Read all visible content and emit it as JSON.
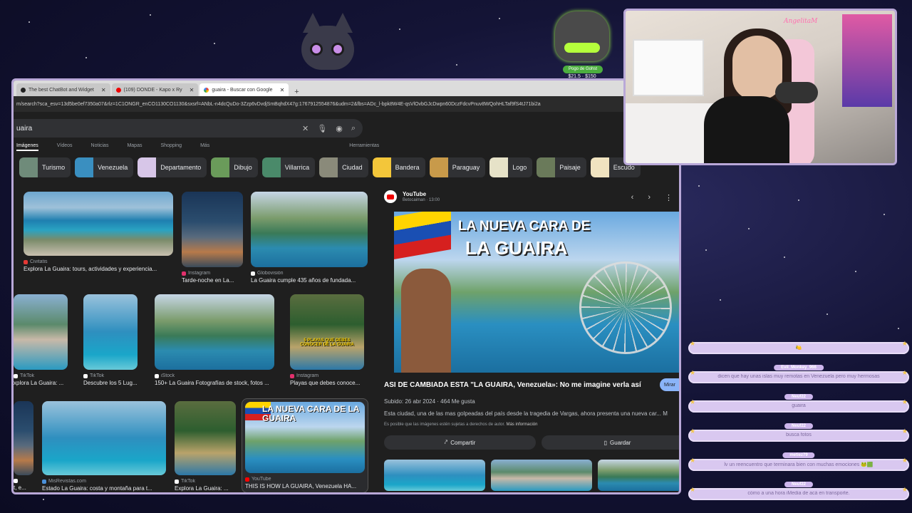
{
  "browser": {
    "tabs": [
      {
        "label": "The best ChatBot and Widget",
        "icon": "heart-icon",
        "active": false
      },
      {
        "label": "(109) DONDE - Kapo x Ry",
        "icon": "youtube-icon",
        "active": false
      },
      {
        "label": "guaira - Buscar con Google",
        "icon": "google-icon",
        "active": true
      }
    ],
    "new_tab": "+",
    "url": "m/search?sca_esv=13d5be0ef7350a07&rlz=1C1ONGR_enCO1130CO1130&sxsrf=ANbL-n4dcQuDo-3Zzp6vDvdjSmBqhdX47g:1767912554876&udm=2&fbs=ADc_l-bpk8W4E-qsVlOvbGJcDwpn60DczFdcvPnuv8WQohHLTaf9fS4tJ71bi2a"
  },
  "search": {
    "query": "uaira",
    "clear_icon": "✕",
    "mic_icon": "🎙",
    "lens_icon": "◉",
    "search_icon": "⌕",
    "nav": [
      "Imágenes",
      "Vídeos",
      "Noticias",
      "Mapas",
      "Shopping",
      "Más",
      "Herramientas"
    ]
  },
  "chips": [
    {
      "label": "Turismo",
      "color": "#6f8b7a"
    },
    {
      "label": "Venezuela",
      "color": "#3a8fc0"
    },
    {
      "label": "Departamento",
      "color": "#d7c6e8"
    },
    {
      "label": "Dibujo",
      "color": "#6a9b5a"
    },
    {
      "label": "Villarrica",
      "color": "#4a8a6a"
    },
    {
      "label": "Ciudad",
      "color": "#8a8a7a"
    },
    {
      "label": "Bandera",
      "color": "#f3c63a"
    },
    {
      "label": "Paraguay",
      "color": "#c89a4a"
    },
    {
      "label": "Logo",
      "color": "#e6e2c8"
    },
    {
      "label": "Paisaje",
      "color": "#6a7a5a"
    },
    {
      "label": "Escudo",
      "color": "#f0e3c0"
    }
  ],
  "results": [
    {
      "source": "Civitatis",
      "title": "Explora La Guaira: tours, actividades y experiencia...",
      "src_color": "#e53935"
    },
    {
      "source": "Instagram",
      "title": "Tarde-noche en La...",
      "src_color": "#e1306c"
    },
    {
      "source": "Globovisión",
      "title": "La Guaira cumple 435 años de fundada...",
      "src_color": "#f5f5f5"
    },
    {
      "source": "TikTok",
      "title": "xplora La Guaira: ...",
      "src_color": "#ffffff"
    },
    {
      "source": "TikTok",
      "title": "Descubre los 5 Lug...",
      "src_color": "#ffffff"
    },
    {
      "source": "iStock",
      "title": "150+ La Guaira Fotografías de stock, fotos ...",
      "src_color": "#ffffff"
    },
    {
      "source": "Instagram",
      "title": "Playas que debes conoce...",
      "src_color": "#e1306c"
    },
    {
      "source": "MisRevistas.com",
      "title": "Estado La Guaira: costa y montaña para t...",
      "src_color": "#4a90d9"
    },
    {
      "source": "TikTok",
      "title": "Explora La Guaira: ...",
      "src_color": "#ffffff"
    },
    {
      "source": "YouTube",
      "title": "THIS IS HOW LA GUAIRA, Venezuela HA...",
      "src_color": "#ff0000"
    },
    {
      "source": "",
      "title": "t, e...",
      "src_color": "#ffffff"
    }
  ],
  "thumb_text": {
    "playas": "5 PLAYAS QUE DEBES CONOCER DE LA GUAIRA",
    "nueva": "LA NUEVA CARA DE LA GUAIRA"
  },
  "preview": {
    "source": "YouTube",
    "channel": "Betocaiman · 13:00",
    "prev": "‹",
    "next": "›",
    "more": "⋮",
    "headline1": "LA NUEVA CARA DE",
    "headline2": "LA GUAIRA",
    "video_title": "ASI DE CAMBIADA ESTA \"LA GUAIRA, Venezuela»: No me imagine verla así",
    "watch": "Mirar",
    "meta": "Subido: 26 abr 2024 · 464 Me gusta",
    "description": "Esta ciudad, una de las mas golpeadas del país desde la tragedia de Vargas, ahora presenta una nueva car... M",
    "note_prefix": "Es posible que las imágenes estén sujetas a derechos de autor.",
    "note_link": "Más información",
    "share": "Compartir",
    "save": "Guardar"
  },
  "controller": {
    "badge": "Pogo de Gohst",
    "price": "$21.5 · $150"
  },
  "webcam": {
    "sign": "AngelitaM"
  },
  "chat": [
    {
      "user": "",
      "text": "🍋"
    },
    {
      "user": "Evil_Monkey_966",
      "text": "dicen que hay unas islas muy remotas en Venezuela pero muy hermosas"
    },
    {
      "user": "Neuf22",
      "text": "guaira"
    },
    {
      "user": "Neuf22",
      "text": "busca fotos"
    },
    {
      "user": "metiez79",
      "text": "lv un reencuentro que terminara bien con muchas emociones 🐸🟩"
    },
    {
      "user": "Neuf22",
      "text": "cómo a una hora iMedia de acá en transporte."
    }
  ]
}
